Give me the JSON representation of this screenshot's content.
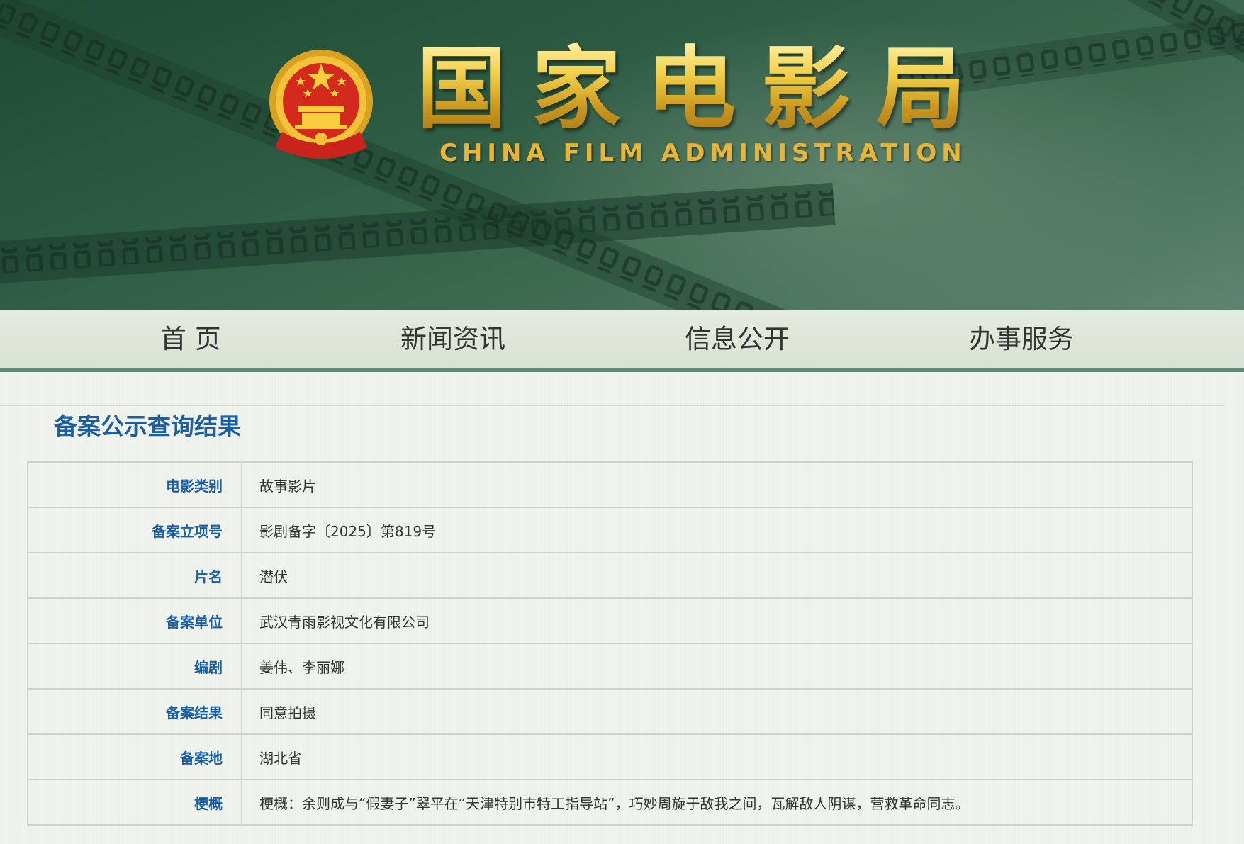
{
  "header": {
    "title_cn_chars": [
      "国",
      "家",
      "电",
      "影",
      "局"
    ],
    "title_en": "CHINA FILM ADMINISTRATION"
  },
  "nav": {
    "items": [
      {
        "label": "首 页"
      },
      {
        "label": "新闻资讯"
      },
      {
        "label": "信息公开"
      },
      {
        "label": "办事服务"
      }
    ]
  },
  "main": {
    "page_title": "备案公示查询结果",
    "rows": [
      {
        "label": "电影类别",
        "value": "故事影片"
      },
      {
        "label": "备案立项号",
        "value": "影剧备字〔2025〕第819号"
      },
      {
        "label": "片名",
        "value": "潜伏"
      },
      {
        "label": "备案单位",
        "value": "武汉青雨影视文化有限公司"
      },
      {
        "label": "编剧",
        "value": "姜伟、李丽娜"
      },
      {
        "label": "备案结果",
        "value": "同意拍摄"
      },
      {
        "label": "备案地",
        "value": "湖北省"
      },
      {
        "label": "梗概",
        "value": "梗概：余则成与“假妻子”翠平在“天津特别市特工指导站”，巧妙周旋于敌我之间，瓦解敌人阴谋，营救革命同志。"
      }
    ]
  },
  "colors": {
    "banner_green": "#2c5a42",
    "gold": "#e8bf3a",
    "title_blue": "#1a5fa4",
    "nav_border": "#5e8a72"
  }
}
